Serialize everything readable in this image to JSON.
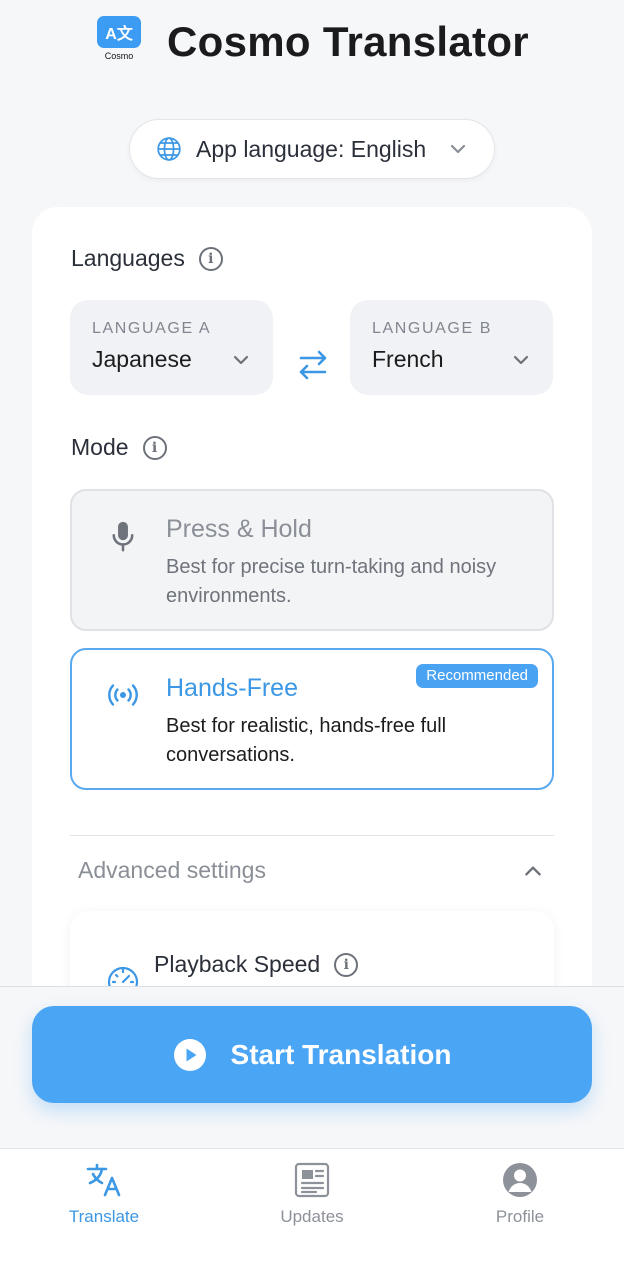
{
  "header": {
    "logo_glyph": "A文",
    "logo_text": "Cosmo",
    "title": "Cosmo Translator"
  },
  "app_language": {
    "label": "App language: English",
    "icon": "globe-icon"
  },
  "languages": {
    "section_title": "Languages",
    "language_a": {
      "caption": "LANGUAGE A",
      "value": "Japanese"
    },
    "language_b": {
      "caption": "LANGUAGE B",
      "value": "French"
    },
    "swap_icon": "swap-arrows-icon"
  },
  "mode": {
    "section_title": "Mode",
    "options": [
      {
        "title": "Press & Hold",
        "description": "Best for precise turn-taking and noisy environments.",
        "icon": "microphone-icon",
        "selected": false
      },
      {
        "title": "Hands-Free",
        "description": "Best for realistic, hands-free full conversations.",
        "icon": "broadcast-icon",
        "badge": "Recommended",
        "selected": true
      }
    ]
  },
  "advanced": {
    "label": "Advanced settings",
    "expanded": true,
    "playback_speed_label": "Playback Speed"
  },
  "start_button": {
    "label": "Start Translation"
  },
  "tabbar": {
    "tabs": [
      {
        "label": "Translate",
        "icon": "translate-icon",
        "active": true
      },
      {
        "label": "Updates",
        "icon": "newspaper-icon",
        "active": false
      },
      {
        "label": "Profile",
        "icon": "person-icon",
        "active": false
      }
    ]
  },
  "colors": {
    "accent": "#4ba5f5",
    "accent_text": "#3c97e4",
    "background": "#f6f7f9"
  }
}
